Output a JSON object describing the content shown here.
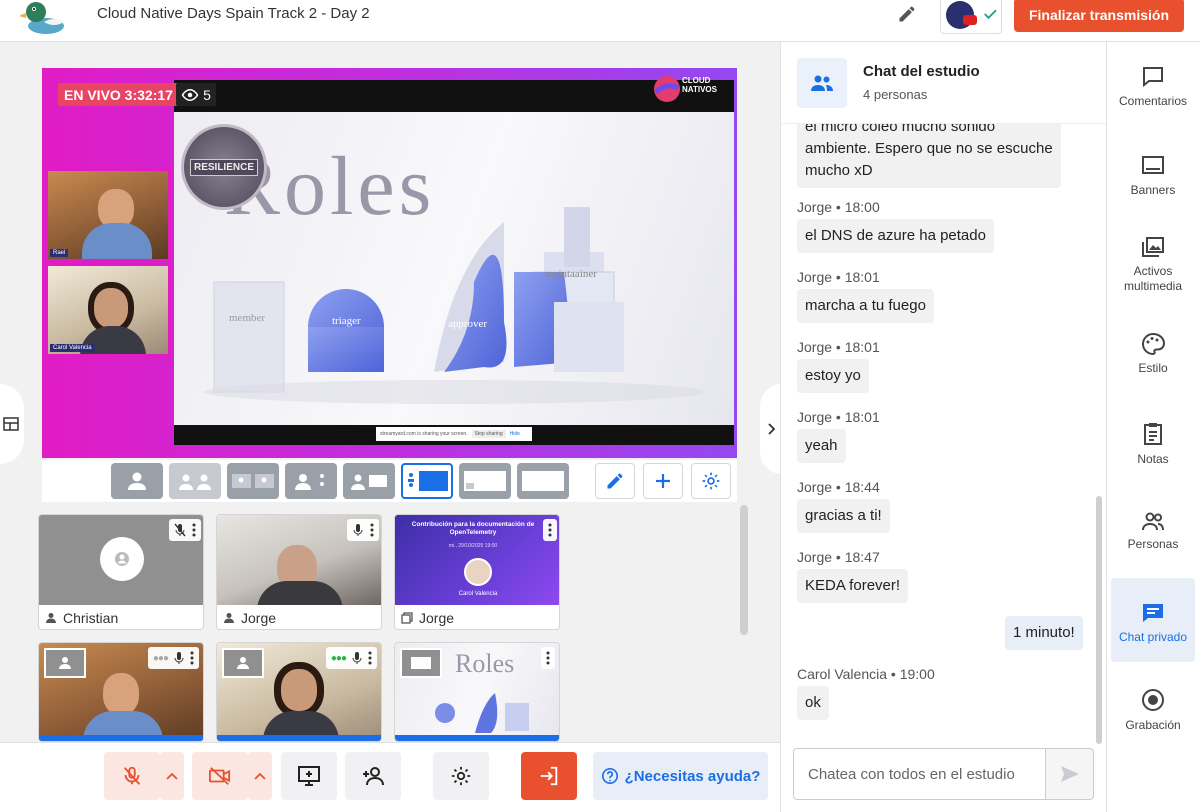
{
  "header": {
    "title": "Cloud Native Days Spain Track 2 - Day 2",
    "end_button": "Finalizar transmisión"
  },
  "stage": {
    "live_label": "EN VIVO 3:32:17",
    "viewer_count": "5",
    "slide_title": "Roles",
    "slide_roles": [
      "member",
      "triager",
      "approver",
      "maintaainer"
    ],
    "slide_badge": "RESILIENCE",
    "brand_text": "CLOUD NATIVOS",
    "cam_tiles": [
      {
        "name": "Rael"
      },
      {
        "name": "Carol Valencia"
      }
    ],
    "share_text": "streamyard.com is sharing your screen.",
    "share_stop": "Stop sharing",
    "share_hide": "Hide"
  },
  "tiles": [
    {
      "name": "Christian",
      "icon": "person-icon"
    },
    {
      "name": "Jorge",
      "icon": "person-icon"
    },
    {
      "name": "Jorge",
      "icon": "screen-share-icon"
    }
  ],
  "tile_preview": {
    "title": "Contribución para la documentación de OpenTelemetry",
    "date": "mi., 29/10/2025 19:00",
    "speaker": "Carol Valencia",
    "slide_title": "Roles"
  },
  "bottom": {
    "help_label": "¿Necesitas ayuda?"
  },
  "chat": {
    "title": "Chat del estudio",
    "subtitle": "4 personas",
    "first_bubble": [
      "el micro coleo mucho sonido",
      "ambiente. Espero que no se escuche",
      "mucho xD"
    ],
    "messages": [
      {
        "author": "Jorge",
        "time": "18:00",
        "text": "el DNS de azure ha petado"
      },
      {
        "author": "Jorge",
        "time": "18:01",
        "text": "marcha a tu fuego"
      },
      {
        "author": "Jorge",
        "time": "18:01",
        "text": "estoy yo"
      },
      {
        "author": "Jorge",
        "time": "18:01",
        "text": "yeah"
      },
      {
        "author": "Jorge",
        "time": "18:44",
        "text": "gracias a ti!"
      },
      {
        "author": "Jorge",
        "time": "18:47",
        "text": "KEDA forever!"
      }
    ],
    "own_message": "1 minuto!",
    "last": {
      "author": "Carol Valencia",
      "time": "19:00",
      "text": "ok"
    },
    "input_placeholder": "Chatea con todos en el estudio",
    "separator": "•"
  },
  "nav": [
    {
      "label": "Comentarios",
      "icon": "comment-icon"
    },
    {
      "label": "Banners",
      "icon": "banner-icon"
    },
    {
      "label": "Activos multimedia",
      "icon": "media-icon"
    },
    {
      "label": "Estilo",
      "icon": "palette-icon"
    },
    {
      "label": "Notas",
      "icon": "notes-icon"
    },
    {
      "label": "Personas",
      "icon": "people-icon"
    },
    {
      "label": "Chat privado",
      "icon": "chat-icon"
    },
    {
      "label": "Grabación",
      "icon": "record-icon"
    }
  ],
  "colors": {
    "accent": "#1b6ee6",
    "end_button": "#e8502e",
    "live": "#e84565",
    "stage_gradient_start": "#e11cc4",
    "stage_gradient_end": "#9448f0",
    "active_nav_bg": "#e8eef8"
  }
}
